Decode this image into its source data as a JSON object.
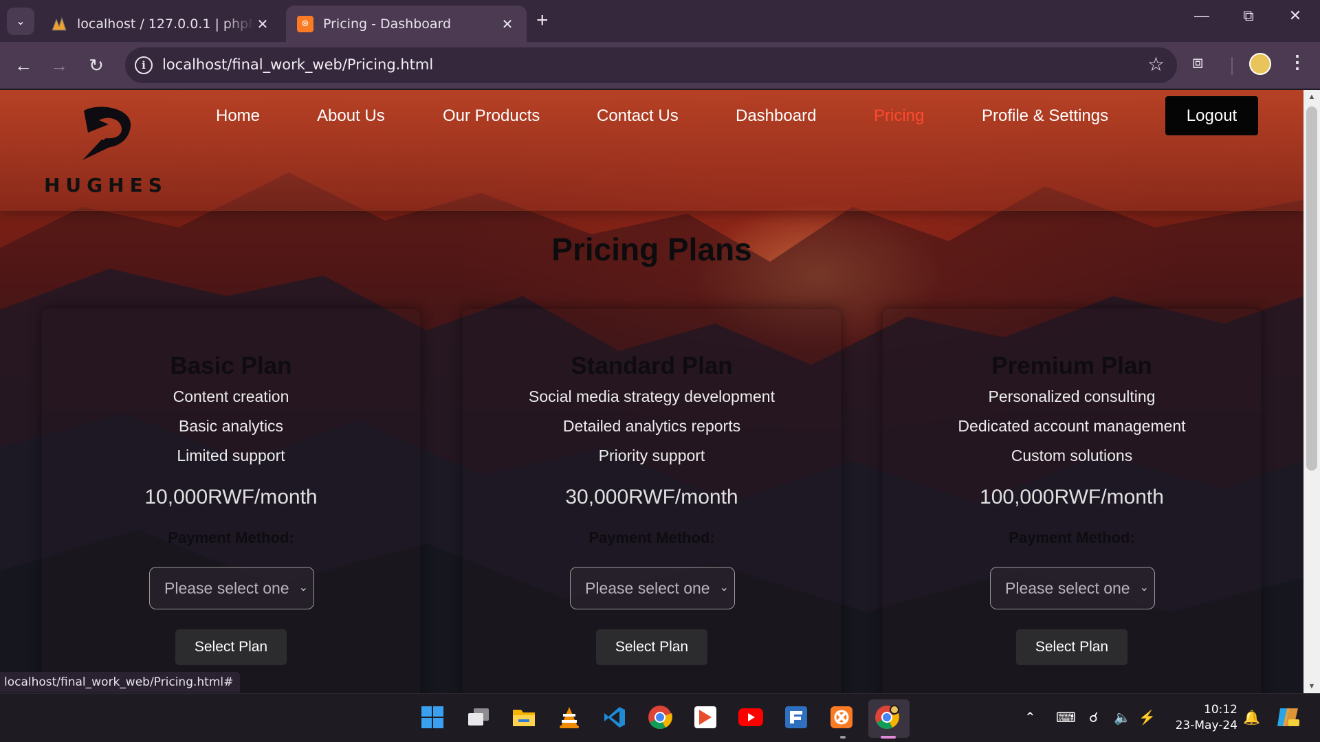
{
  "browser": {
    "tabs": [
      {
        "title": "localhost / 127.0.0.1 | phpMyAdmin",
        "favicon": "phpmyadmin-icon",
        "active": false
      },
      {
        "title": "Pricing - Dashboard",
        "favicon": "xampp-icon",
        "active": true
      }
    ],
    "url": "localhost/final_work_web/Pricing.html",
    "status_url": "localhost/final_work_web/Pricing.html#"
  },
  "site": {
    "logo_text": "HUGHES",
    "nav": [
      {
        "label": "Home",
        "active": false
      },
      {
        "label": "About Us",
        "active": false
      },
      {
        "label": "Our Products",
        "active": false
      },
      {
        "label": "Contact Us",
        "active": false
      },
      {
        "label": "Dashboard",
        "active": false
      },
      {
        "label": "Pricing",
        "active": true
      },
      {
        "label": "Profile & Settings",
        "active": false
      }
    ],
    "logout_label": "Logout",
    "active_nav_color": "#ff4a30"
  },
  "page": {
    "title": "Pricing Plans",
    "plans": [
      {
        "name": "Basic Plan",
        "features": [
          "Content creation",
          "Basic analytics",
          "Limited support"
        ],
        "price": "10,000RWF/month",
        "payment_label": "Payment Method:",
        "select_value": "Please select one",
        "button": "Select Plan"
      },
      {
        "name": "Standard Plan",
        "features": [
          "Social media strategy development",
          "Detailed analytics reports",
          "Priority support"
        ],
        "price": "30,000RWF/month",
        "payment_label": "Payment Method:",
        "select_value": "Please select one",
        "button": "Select Plan"
      },
      {
        "name": "Premium Plan",
        "features": [
          "Personalized consulting",
          "Dedicated account management",
          "Custom solutions"
        ],
        "price": "100,000RWF/month",
        "payment_label": "Payment Method:",
        "select_value": "Please select one",
        "button": "Select Plan"
      }
    ]
  },
  "taskbar": {
    "apps": [
      "windows-start-icon",
      "task-view-icon",
      "file-explorer-icon",
      "vlc-icon",
      "vscode-icon",
      "chrome-icon",
      "media-player-icon",
      "youtube-icon",
      "filezilla-icon",
      "xampp-icon",
      "chrome-profile-icon"
    ],
    "time": "10:12",
    "date": "23-May-24"
  }
}
